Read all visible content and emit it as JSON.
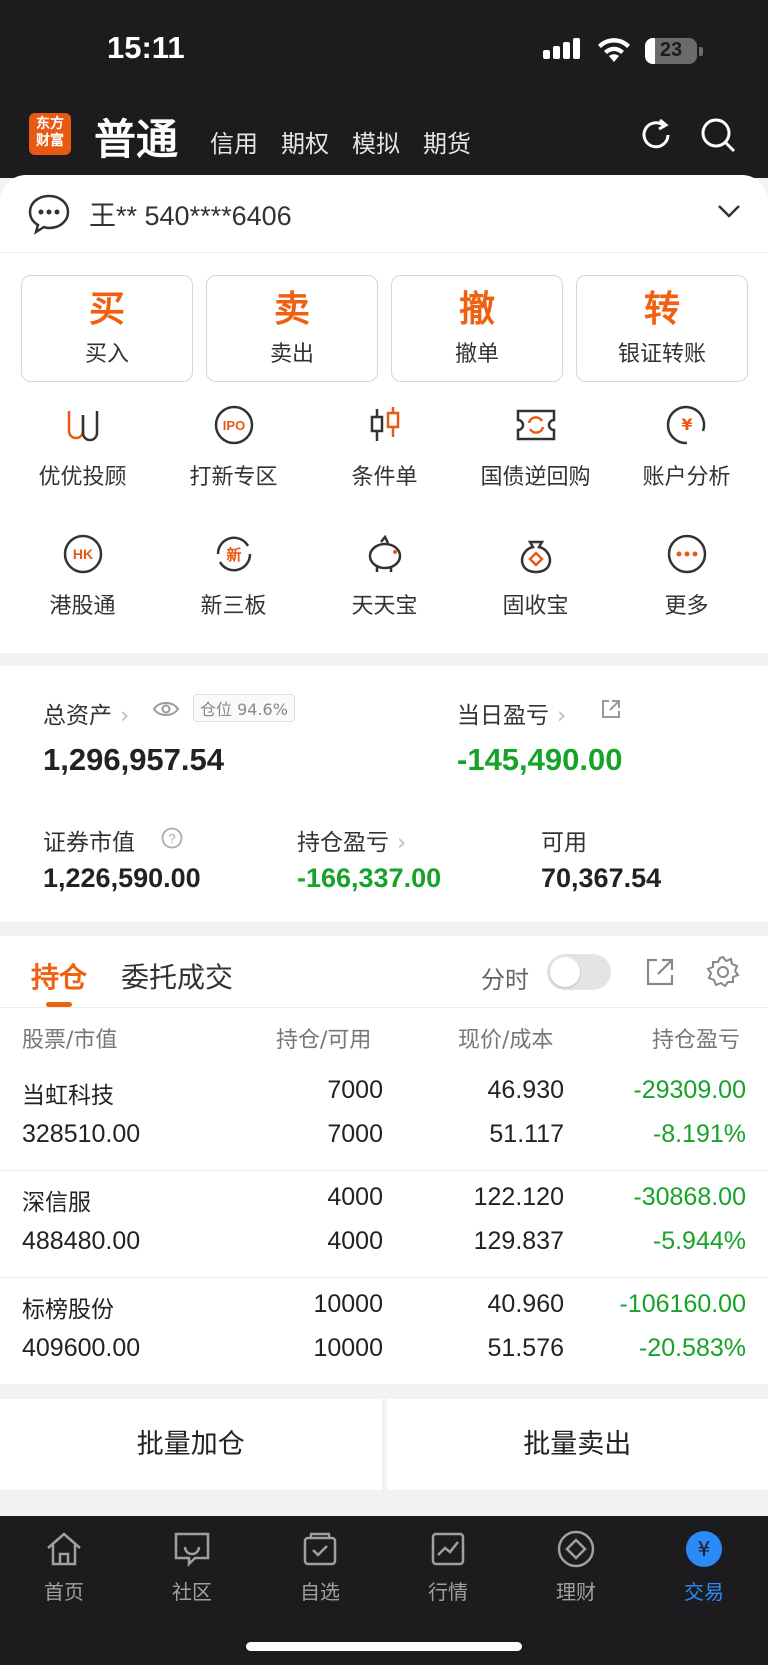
{
  "status_bar": {
    "time": "15:11",
    "battery": "23"
  },
  "header": {
    "logo_line1": "东方",
    "logo_line2": "财富",
    "account_type_active": "普通",
    "tabs": [
      "信用",
      "期权",
      "模拟",
      "期货"
    ]
  },
  "account": {
    "name": "王** 540****6406"
  },
  "actions": [
    {
      "char": "买",
      "label": "买入"
    },
    {
      "char": "卖",
      "label": "卖出"
    },
    {
      "char": "撤",
      "label": "撤单"
    },
    {
      "char": "转",
      "label": "银证转账"
    }
  ],
  "shortcuts_row1": [
    "优优投顾",
    "打新专区",
    "条件单",
    "国债逆回购",
    "账户分析"
  ],
  "shortcuts_row2": [
    "港股通",
    "新三板",
    "天天宝",
    "固收宝",
    "更多"
  ],
  "assets": {
    "total_label": "总资产",
    "position_badge": "仓位 94.6%",
    "total_value": "1,296,957.54",
    "daily_pl_label": "当日盈亏",
    "daily_pl_value": "-145,490.00",
    "market_value_label": "证券市值",
    "market_value": "1,226,590.00",
    "holding_pl_label": "持仓盈亏",
    "holding_pl_value": "-166,337.00",
    "available_label": "可用",
    "available_value": "70,367.54"
  },
  "holdings_tabs": {
    "active": "持仓",
    "other": "委托成交",
    "fenshi": "分时"
  },
  "table_headers": [
    "股票/市值",
    "持仓/可用",
    "现价/成本",
    "持仓盈亏"
  ],
  "holdings": [
    {
      "name": "当虹科技",
      "mv": "328510.00",
      "pos": "7000",
      "avail": "7000",
      "price": "46.930",
      "cost": "51.117",
      "pl": "-29309.00",
      "pct": "-8.191%"
    },
    {
      "name": "深信服",
      "mv": "488480.00",
      "pos": "4000",
      "avail": "4000",
      "price": "122.120",
      "cost": "129.837",
      "pl": "-30868.00",
      "pct": "-5.944%"
    },
    {
      "name": "标榜股份",
      "mv": "409600.00",
      "pos": "10000",
      "avail": "10000",
      "price": "40.960",
      "cost": "51.576",
      "pl": "-106160.00",
      "pct": "-20.583%"
    }
  ],
  "batch": {
    "add": "批量加仓",
    "sell": "批量卖出"
  },
  "nav": [
    {
      "label": "首页",
      "icon": "home-icon"
    },
    {
      "label": "社区",
      "icon": "community-icon"
    },
    {
      "label": "自选",
      "icon": "watchlist-icon"
    },
    {
      "label": "行情",
      "icon": "market-icon"
    },
    {
      "label": "理财",
      "icon": "wealth-icon"
    },
    {
      "label": "交易",
      "icon": "trade-icon"
    }
  ],
  "colors": {
    "accent": "#f06011",
    "loss_green": "#16a329",
    "nav_active": "#2b8af7",
    "dark": "#1c1c1e"
  }
}
